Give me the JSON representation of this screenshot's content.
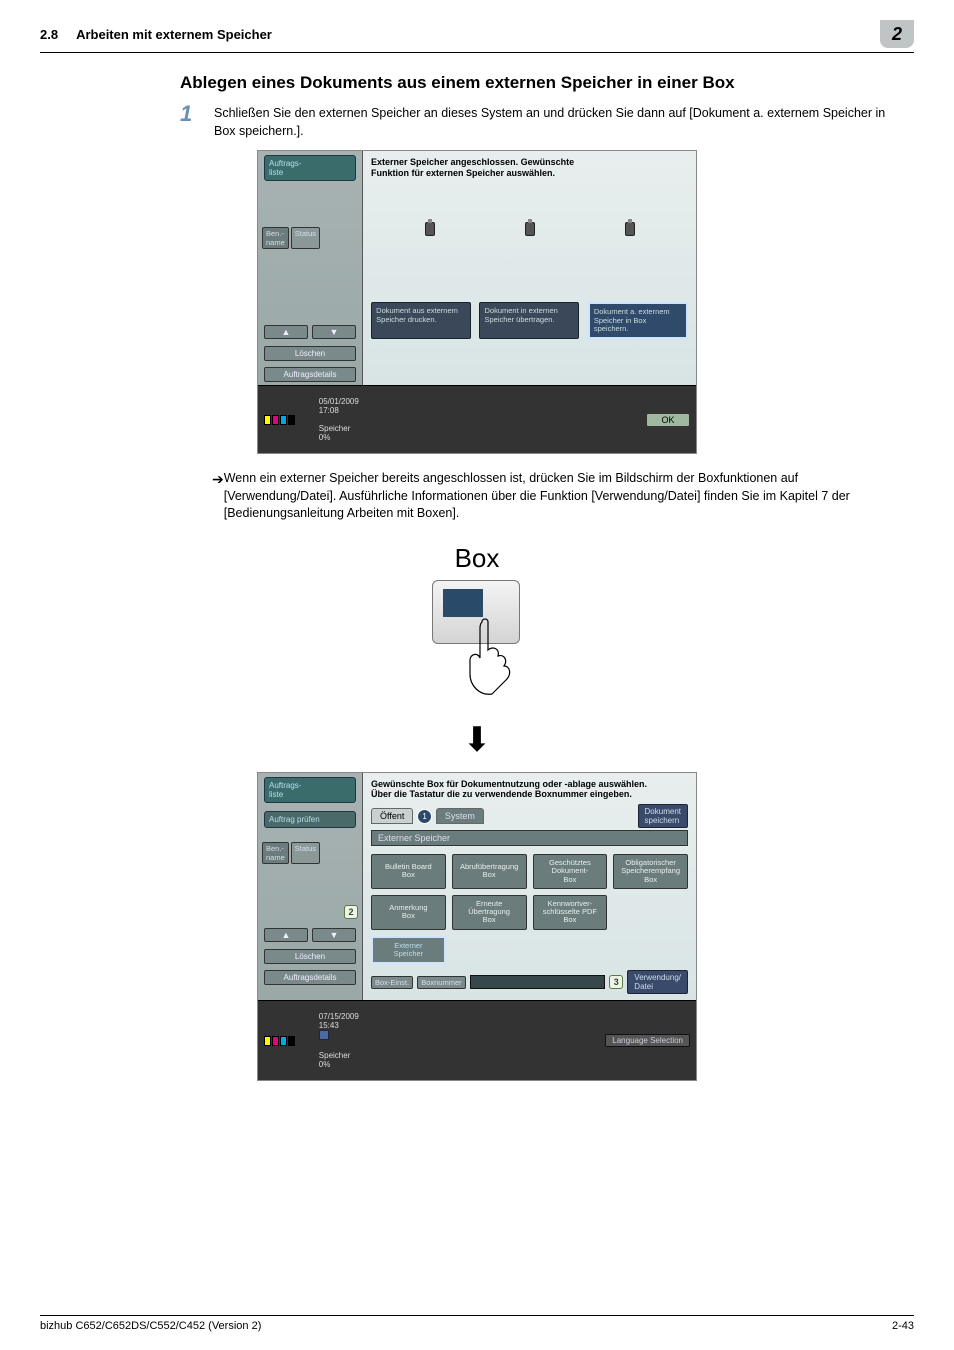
{
  "header": {
    "section_number": "2.8",
    "section_title": "Arbeiten mit externem Speicher",
    "chapter": "2"
  },
  "topic": "Ablegen eines Dokuments aus einem externen Speicher in einer Box",
  "step1": {
    "num": "1",
    "text": "Schließen Sie den externen Speicher an dieses System an und drücken Sie dann auf [Dokument a. externem Speicher in Box speichern.]."
  },
  "screen1": {
    "sidebar": {
      "joblist": "Auftrags-\nliste",
      "benname": "Ben.-\nname",
      "status": "Status",
      "delete": "Löschen",
      "details": "Auftragsdetails"
    },
    "message": "Externer Speicher angeschlossen. Gewünschte\nFunktion für externen Speicher auswählen.",
    "options": {
      "a": "Dokument aus externem Speicher drucken.",
      "b": "Dokument in externen Speicher übertragen.",
      "c": "Dokument a. externem Speicher in Box speichern."
    },
    "statusbar": {
      "date": "05/01/2009",
      "time": "17:08",
      "mem_label": "Speicher",
      "mem_val": "0%",
      "ok": "OK"
    }
  },
  "note": "Wenn ein externer Speicher bereits angeschlossen ist, drücken Sie im Bildschirm der Boxfunktionen auf [Verwendung/Datei]. Ausführliche Informationen über die Funktion [Verwendung/Datei] finden Sie im Kapitel 7 der [Bedienungsanleitung Arbeiten mit Boxen].",
  "box_label": "Box",
  "screen2": {
    "sidebar": {
      "joblist": "Auftrags-\nliste",
      "jobcheck": "Auftrag\nprüfen",
      "benname": "Ben.-\nname",
      "status": "Status",
      "delete": "Löschen",
      "details": "Auftragsdetails"
    },
    "message": "Gewünschte Box für Dokumentnutzung oder -ablage auswählen.\nÜber die Tastatur die zu verwendende Boxnummer eingeben.",
    "tabs": {
      "public": "Öffent",
      "badge1": "1",
      "system": "System",
      "save_doc": "Dokument\nspeichern"
    },
    "sub_bar": "Externer Speicher",
    "boxes": {
      "bulletin": "Bulletin Board\nBox",
      "polling": "Abrufübertragung\nBox",
      "secure": "Geschütztes\nDokument-\nBox",
      "memrx": "Obligatorischer\nSpeicherempfang\nBox",
      "annot": "Anmerkung\nBox",
      "retrans": "Erneute\nÜbertragung\nBox",
      "pwpdf": "Kennwortver-\nschlüsselte PDF\nBox",
      "external": "Externer\nSpeicher"
    },
    "marker2": "2",
    "marker3": "3",
    "bottom": {
      "boxset": "Box-Einst.",
      "boxnum": "Boxnummer",
      "usage": "Verwendung/\nDatei"
    },
    "statusbar": {
      "date": "07/15/2009",
      "time": "15:43",
      "mem_label": "Speicher",
      "mem_val": "0%",
      "lang": "Language Selection"
    }
  },
  "footer": {
    "model": "bizhub C652/C652DS/C552/C452 (Version 2)",
    "page": "2-43"
  }
}
